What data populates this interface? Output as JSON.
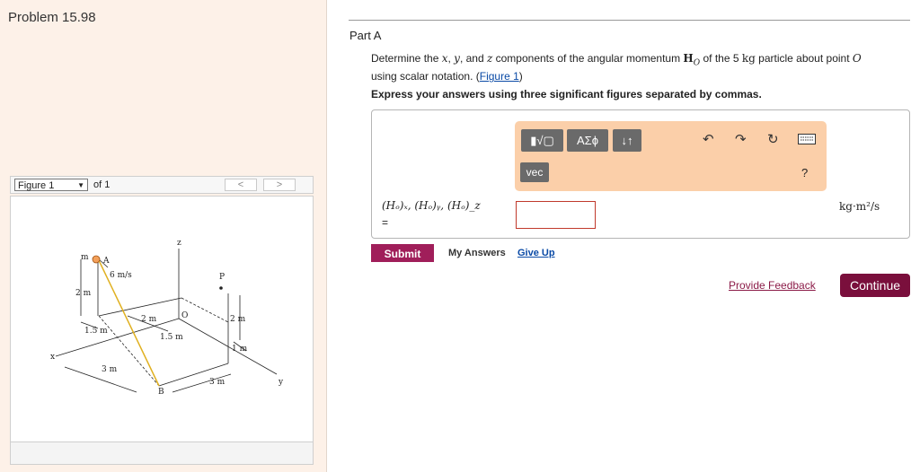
{
  "problem": {
    "title": "Problem 15.98"
  },
  "figure_nav": {
    "select_value": "Figure 1",
    "of_text": "of 1",
    "prev_label": "<",
    "next_label": ">"
  },
  "figure": {
    "labels": {
      "z": "z",
      "y": "y",
      "x": "x",
      "m": "m",
      "A": "A",
      "O": "O",
      "P": "P",
      "B": "B",
      "vel": "6 m/s",
      "d_2m_left": "2 m",
      "d_15m_left": "1.5 m",
      "d_2m_mid": "2 m",
      "d_15m_mid": "1.5 m",
      "d_2m_right": "2 m",
      "d_1m": "1 m",
      "d_3m_left": "3 m",
      "d_3m_bottom": "3 m"
    }
  },
  "part": {
    "label": "Part A",
    "q_before": "Determine the ",
    "q_x": "x",
    "q_sep1": ", ",
    "q_y": "y",
    "q_sep2": ", and ",
    "q_z": "z",
    "q_mid": " components of the angular momentum ",
    "q_H": "H",
    "q_Hsub": "O",
    "q_mid2": " of the 5 ",
    "q_kg": "kg",
    "q_mid3": " particle about point ",
    "q_O": "O",
    "q_line2": "using scalar notation. (",
    "q_link": "Figure 1",
    "q_close": ")",
    "instruction": "Express your answers using three significant figures separated by commas."
  },
  "toolbar": {
    "templates_label": "▮√▢",
    "symbols_label": "ΑΣϕ",
    "arrows_label": "↓↑",
    "undo_icon": "undo-icon",
    "redo_icon": "redo-icon",
    "reset_icon": "reset-icon",
    "keyboard_icon": "keyboard-icon",
    "vec_label": "vec",
    "help_label": "?"
  },
  "answer": {
    "label": "(Hₒ)ₓ, (Hₒ)ᵧ, (Hₒ)_z",
    "equals": "=",
    "value": "",
    "unit": "kg·m²/s"
  },
  "actions": {
    "submit": "Submit",
    "my_answers": "My Answers",
    "give_up": "Give Up",
    "feedback": "Provide Feedback",
    "continue": "Continue"
  },
  "colors": {
    "submit": "#a01e5a",
    "continue": "#7a0f3c",
    "toolbar_bg": "#fbcfa9",
    "input_border": "#c0392b"
  }
}
